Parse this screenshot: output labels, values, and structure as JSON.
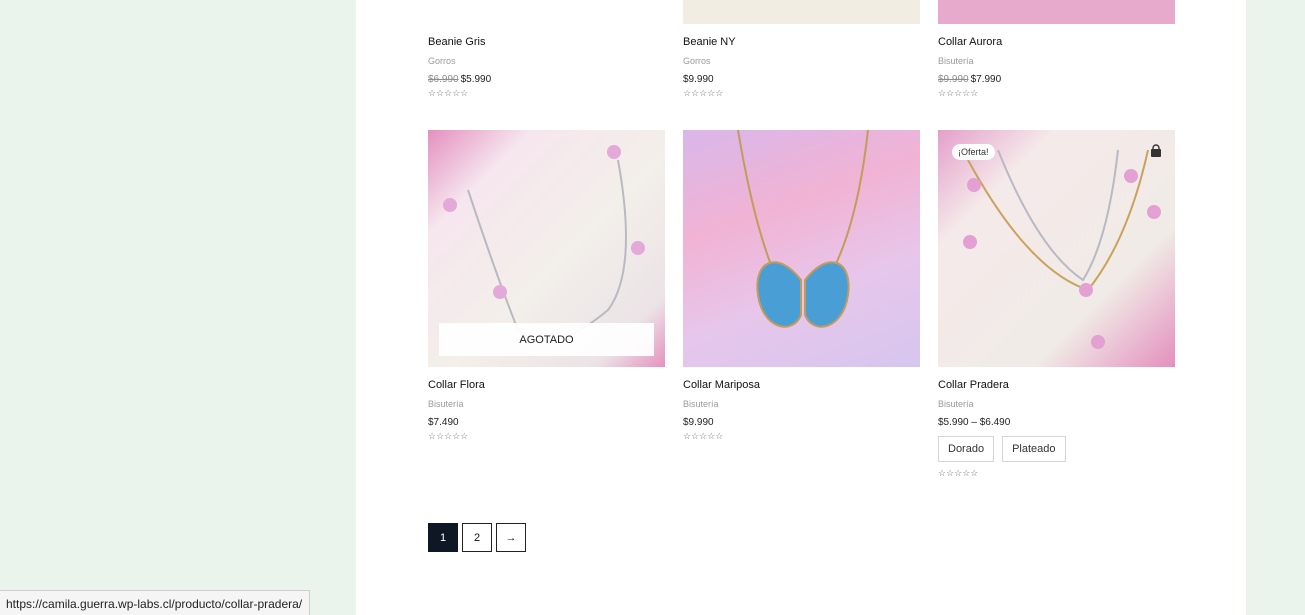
{
  "colors": {
    "page_bg": "#eaf4ec",
    "content_bg": "#ffffff",
    "active_page": "#0e1726"
  },
  "products_top": [
    {
      "name": "Beanie Gris",
      "category": "Gorros",
      "old_price": "$6.990",
      "price": "$5.990",
      "stars": "☆☆☆☆☆"
    },
    {
      "name": "Beanie NY",
      "category": "Gorros",
      "old_price": "",
      "price": "$9.990",
      "stars": "☆☆☆☆☆"
    },
    {
      "name": "Collar Aurora",
      "category": "Bisutería",
      "old_price": "$9.990",
      "price": "$7.990",
      "stars": "☆☆☆☆☆"
    }
  ],
  "products_bottom": [
    {
      "name": "Collar Flora",
      "category": "Bisutería",
      "price": "$7.490",
      "stars": "☆☆☆☆☆",
      "overlay": "AGOTADO"
    },
    {
      "name": "Collar Mariposa",
      "category": "Bisutería",
      "price": "$9.990",
      "stars": "☆☆☆☆☆"
    },
    {
      "name": "Collar Pradera",
      "category": "Bisutería",
      "price": "$5.990 – $6.490",
      "stars": "☆☆☆☆☆",
      "badge": "¡Oferta!",
      "icon": "shopping-bag-icon",
      "variants": [
        "Dorado",
        "Plateado"
      ]
    }
  ],
  "pagination": {
    "pages": [
      "1",
      "2"
    ],
    "next": "→",
    "current": "1"
  },
  "status_bar": {
    "url": "https://camila.guerra.wp-labs.cl/producto/collar-pradera/"
  }
}
